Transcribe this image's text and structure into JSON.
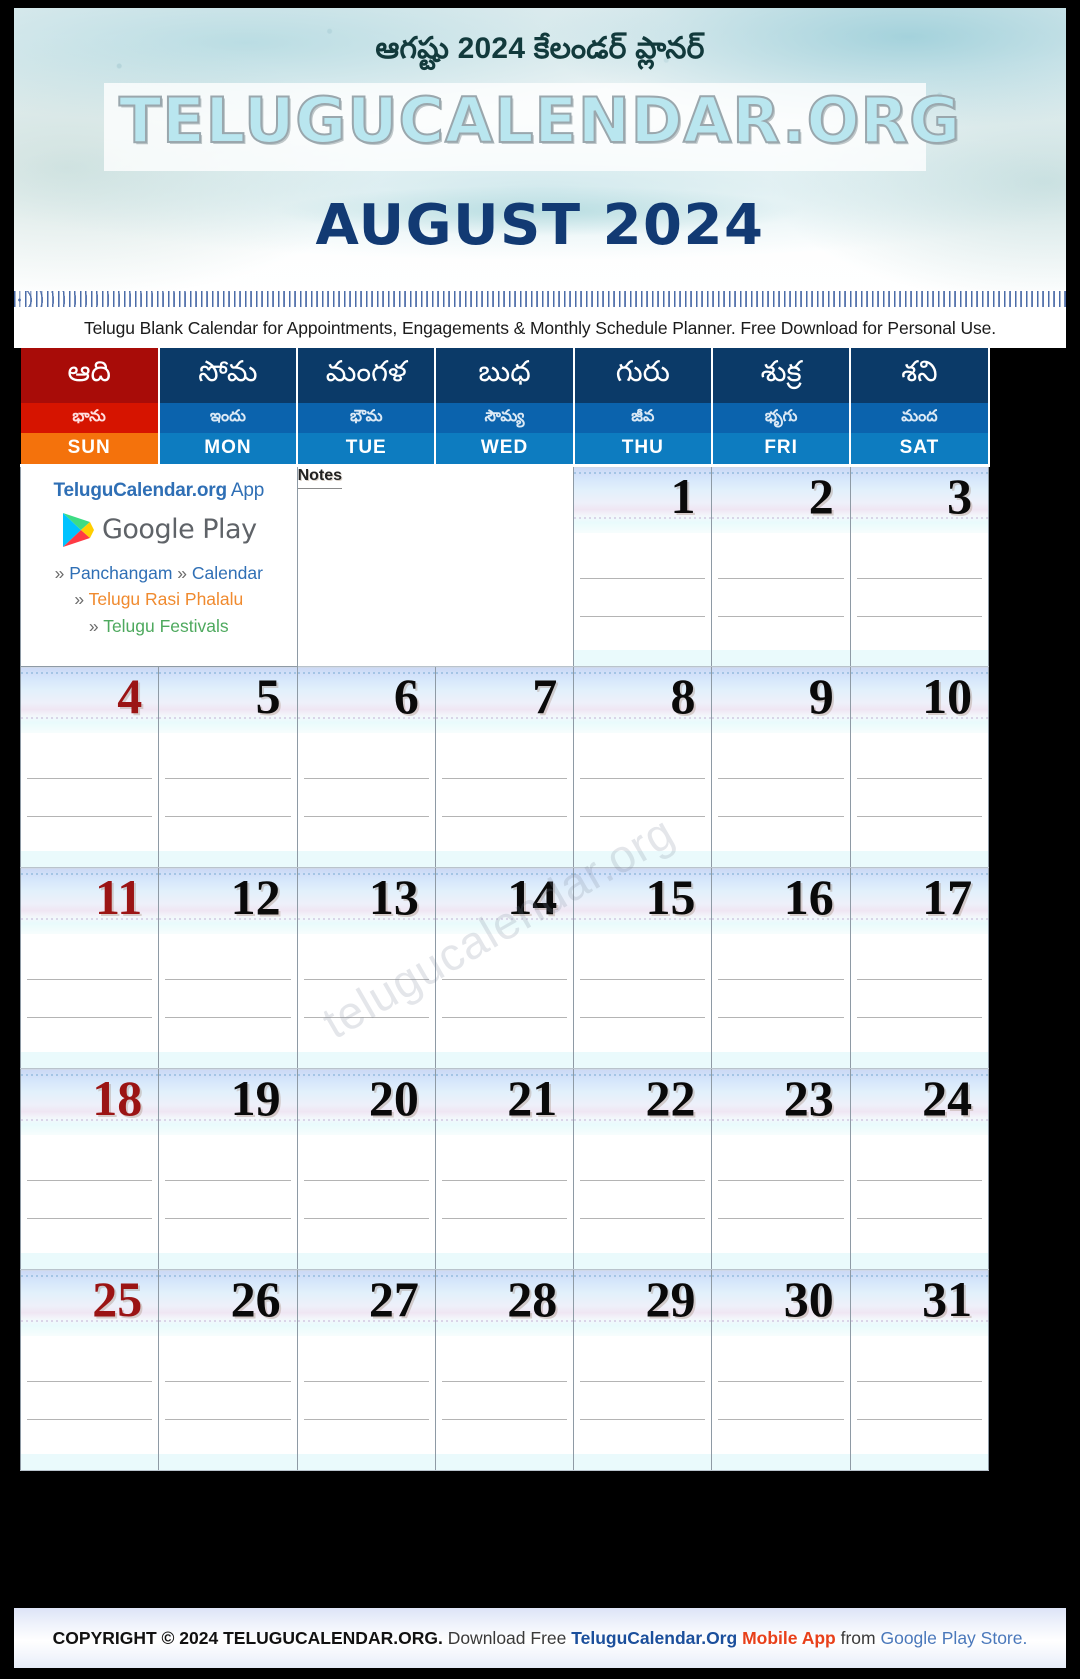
{
  "header": {
    "telugu_title": "ఆగష్టు 2024 కేలండర్ ప్లానర్",
    "logo": "TELUGUCALENDAR.ORG",
    "month_title": "AUGUST 2024",
    "subtitle": "Telugu Blank Calendar for Appointments, Engagements & Monthly Schedule Planner. Free Download for Personal Use."
  },
  "colors": {
    "sun_header": "#a80c08",
    "sun_alt": "#d61400",
    "sun_abbr": "#f4720c",
    "weekday_header": "#0b3a68",
    "weekday_alt": "#0b63ad",
    "weekday_abbr": "#0d7cc0",
    "month_title": "#123a73",
    "sunday_date": "#9b1414",
    "link_blue": "#2f6fb5",
    "link_orange": "#f08a2e",
    "link_green": "#4ea95e"
  },
  "weekdays": [
    {
      "telugu": "ఆది",
      "alt": "భాను",
      "abbr": "SUN"
    },
    {
      "telugu": "సోమ",
      "alt": "ఇందు",
      "abbr": "MON"
    },
    {
      "telugu": "మంగళ",
      "alt": "భౌమ",
      "abbr": "TUE"
    },
    {
      "telugu": "బుధ",
      "alt": "సౌమ్య",
      "abbr": "WED"
    },
    {
      "telugu": "గురు",
      "alt": "జీవ",
      "abbr": "THU"
    },
    {
      "telugu": "శుక్ర",
      "alt": "భృగు",
      "abbr": "FRI"
    },
    {
      "telugu": "శని",
      "alt": "మంద",
      "abbr": "SAT"
    }
  ],
  "app_panel": {
    "title_brand": "TeluguCalendar.org",
    "title_suffix": "App",
    "store_name": "Google Play",
    "link_panchangam": "Panchangam",
    "link_calendar": "Calendar",
    "link_rasi": "Telugu Rasi Phalalu",
    "link_festivals": "Telugu Festivals",
    "chevron": "»"
  },
  "notes": {
    "label": "Notes"
  },
  "watermark": "telugucalendar.org",
  "weeks": [
    [
      null,
      null,
      null,
      null,
      {
        "date": "1",
        "sunday": false
      },
      {
        "date": "2",
        "sunday": false
      },
      {
        "date": "3",
        "sunday": false
      }
    ],
    [
      {
        "date": "4",
        "sunday": true
      },
      {
        "date": "5",
        "sunday": false
      },
      {
        "date": "6",
        "sunday": false
      },
      {
        "date": "7",
        "sunday": false
      },
      {
        "date": "8",
        "sunday": false
      },
      {
        "date": "9",
        "sunday": false
      },
      {
        "date": "10",
        "sunday": false
      }
    ],
    [
      {
        "date": "11",
        "sunday": true
      },
      {
        "date": "12",
        "sunday": false
      },
      {
        "date": "13",
        "sunday": false
      },
      {
        "date": "14",
        "sunday": false
      },
      {
        "date": "15",
        "sunday": false
      },
      {
        "date": "16",
        "sunday": false
      },
      {
        "date": "17",
        "sunday": false
      }
    ],
    [
      {
        "date": "18",
        "sunday": true
      },
      {
        "date": "19",
        "sunday": false
      },
      {
        "date": "20",
        "sunday": false
      },
      {
        "date": "21",
        "sunday": false
      },
      {
        "date": "22",
        "sunday": false
      },
      {
        "date": "23",
        "sunday": false
      },
      {
        "date": "24",
        "sunday": false
      }
    ],
    [
      {
        "date": "25",
        "sunday": true
      },
      {
        "date": "26",
        "sunday": false
      },
      {
        "date": "27",
        "sunday": false
      },
      {
        "date": "28",
        "sunday": false
      },
      {
        "date": "29",
        "sunday": false
      },
      {
        "date": "30",
        "sunday": false
      },
      {
        "date": "31",
        "sunday": false
      }
    ]
  ],
  "footer": {
    "copyright": "COPYRIGHT © 2024 TELUGUCALENDAR.ORG.",
    "download": "Download Free",
    "brand": "TeluguCalendar.Org",
    "app": "Mobile App",
    "from": "from",
    "store": "Google Play Store."
  }
}
